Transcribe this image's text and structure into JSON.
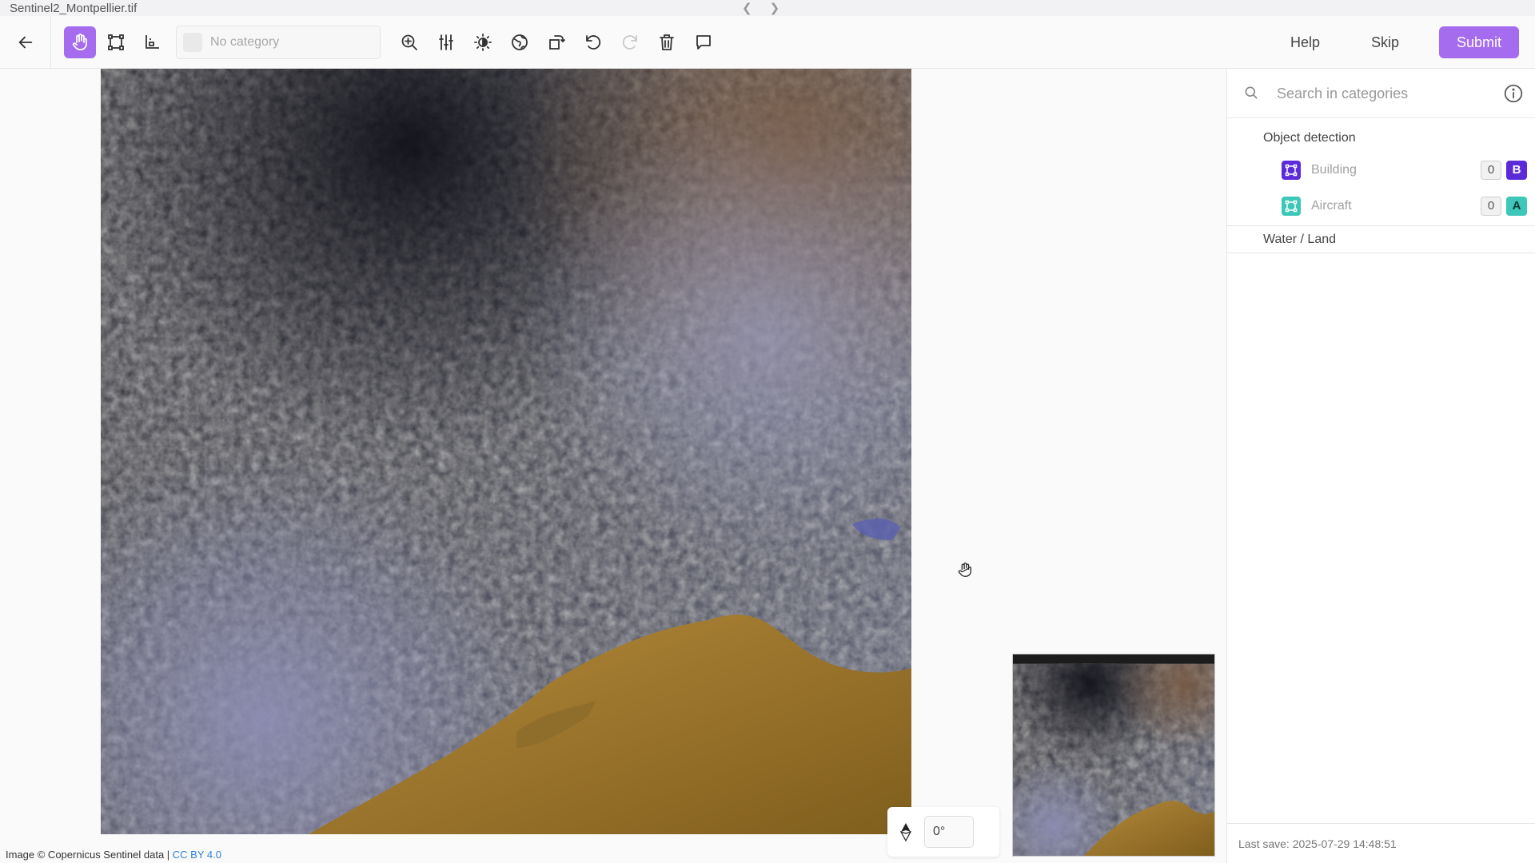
{
  "window": {
    "title": "Sentinel2_Montpellier.tif"
  },
  "toolbar": {
    "category_placeholder": "No category",
    "help_label": "Help",
    "skip_label": "Skip",
    "submit_label": "Submit"
  },
  "canvas": {
    "rotation_value": "0°",
    "attribution_text": "Image © Copernicus Sentinel data | ",
    "attribution_link": "CC BY 4.0"
  },
  "sidebar": {
    "search_placeholder": "Search in categories",
    "groups": [
      {
        "label": "Object detection",
        "items": [
          {
            "label": "Building",
            "count": "0",
            "key": "B",
            "icon": "bbox-icon",
            "color": "#5b2bd9"
          },
          {
            "label": "Aircraft",
            "count": "0",
            "key": "A",
            "icon": "bbox-icon",
            "color": "#3cc7b8"
          }
        ]
      },
      {
        "label": "Water / Land",
        "items": []
      }
    ],
    "last_save": "Last save: 2025-07-29 14:48:51"
  },
  "colors": {
    "accent": "#a56cf0",
    "building": "#5b2bd9",
    "aircraft": "#3cc7b8",
    "link": "#2f7fd8"
  }
}
